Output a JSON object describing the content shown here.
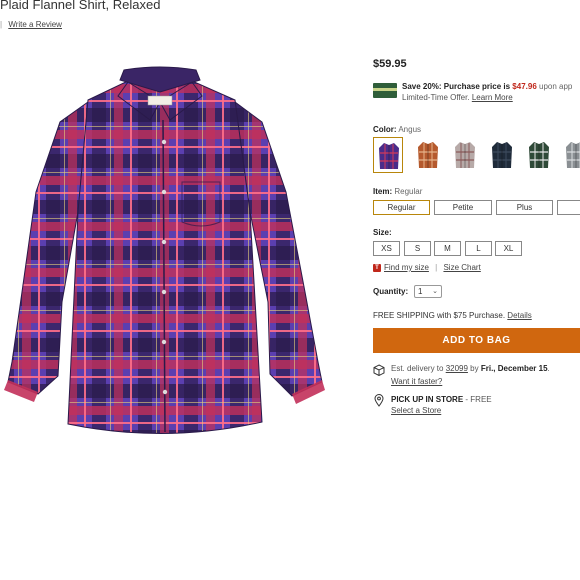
{
  "product": {
    "title": "Plaid Flannel Shirt, Relaxed",
    "review_sep": "|",
    "review_link": "Write a Review",
    "price": "$59.95"
  },
  "promo": {
    "line1_prefix": "Save 20%: Purchase price is ",
    "line1_price": "$47.96",
    "line1_suffix": " upon app",
    "line2_text": "Limited-Time Offer.",
    "line2_link": "Learn More"
  },
  "color": {
    "label": "Color:",
    "value": "Angus",
    "swatches": [
      {
        "name": "Angus",
        "base": "#4a2c8a",
        "line": "#d23a5a"
      },
      {
        "name": "Rust plaid",
        "base": "#b55a2e",
        "line": "#e6b48a"
      },
      {
        "name": "Gray plaid",
        "base": "#b7aaa8",
        "line": "#8a5a5a"
      },
      {
        "name": "Navy",
        "base": "#1f2b3a",
        "line": "#3d4b5e"
      },
      {
        "name": "Green plaid",
        "base": "#2f4a38",
        "line": "#e8e8e8"
      },
      {
        "name": "Gray check",
        "base": "#8a8f93",
        "line": "#d9dcdf"
      }
    ]
  },
  "item": {
    "label": "Item:",
    "value": "Regular",
    "options": [
      "Regular",
      "Petite",
      "Plus",
      ""
    ]
  },
  "size": {
    "label": "Size:",
    "options": [
      "XS",
      "S",
      "M",
      "L",
      "XL"
    ],
    "find_link": "Find my size",
    "sep": "|",
    "chart_link": "Size Chart"
  },
  "quantity": {
    "label": "Quantity:",
    "value": "1"
  },
  "shipping": {
    "text": "FREE SHIPPING with $75 Purchase.",
    "link": "Details"
  },
  "add_to_bag": "ADD TO BAG",
  "delivery": {
    "prefix": "Est. delivery to ",
    "zip": "32099",
    "middle": " by ",
    "date": "Fri., December 15",
    "suffix": ".",
    "link": "Want it faster?"
  },
  "pickup": {
    "label": "PICK UP IN STORE",
    "free": " - FREE",
    "link": "Select a Store"
  },
  "colors": {
    "accent_orange": "#d0670f",
    "price_red": "#c0271b",
    "selected_border": "#b8860b"
  }
}
